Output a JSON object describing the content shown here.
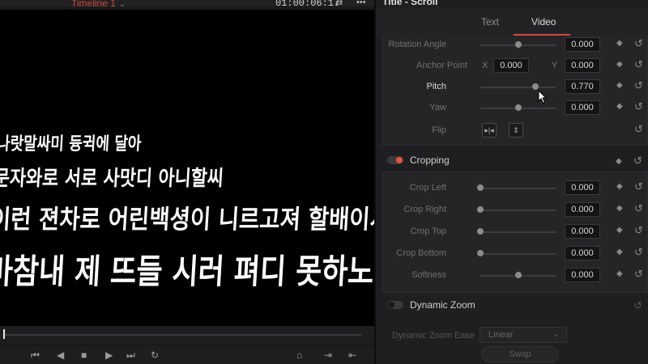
{
  "viewer": {
    "timeline_name": "Timeline 1",
    "timecode": "01:00:06:17",
    "canvas_lines": [
      "나랏말싸미 듕귁에 달아",
      "문자와로 서로 사맛디 아니할씨",
      "이런 젼차로 어린백셩이 니르고져 할배이셔도",
      "마참내 제 뜨들 시러 펴디 못하노미하니라"
    ],
    "scrub_position": 0.0
  },
  "inspector": {
    "title": "Title - Scroll",
    "tabs": [
      {
        "label": "Text",
        "active": false
      },
      {
        "label": "Video",
        "active": true
      }
    ],
    "transform": [
      {
        "label": "Rotation Angle",
        "value": "0.000",
        "slider": 0.5
      },
      {
        "label": "Anchor Point",
        "x_label": "X",
        "x": "0.000",
        "y_label": "Y",
        "y": "0.000"
      },
      {
        "label": "Pitch",
        "value": "0.770",
        "slider": 0.72
      },
      {
        "label": "Yaw",
        "value": "0.000",
        "slider": 0.5
      },
      {
        "label": "Flip"
      }
    ],
    "cropping": {
      "title": "Cropping",
      "enabled": true,
      "rows": [
        {
          "label": "Crop Left",
          "value": "0.000",
          "slider": 0.0
        },
        {
          "label": "Crop Right",
          "value": "0.000",
          "slider": 0.0
        },
        {
          "label": "Crop Top",
          "value": "0.000",
          "slider": 0.0
        },
        {
          "label": "Crop Bottom",
          "value": "0.000",
          "slider": 0.0
        },
        {
          "label": "Softness",
          "value": "0.000",
          "slider": 0.5
        }
      ]
    },
    "dynamic_zoom": {
      "title": "Dynamic Zoom",
      "enabled": false,
      "ease_label": "Dynamic Zoom Ease",
      "ease_value": "Linear",
      "swap_label": "Swap"
    }
  },
  "colors": {
    "accent": "#d04a3a",
    "toggle_on": "#e8533e"
  }
}
